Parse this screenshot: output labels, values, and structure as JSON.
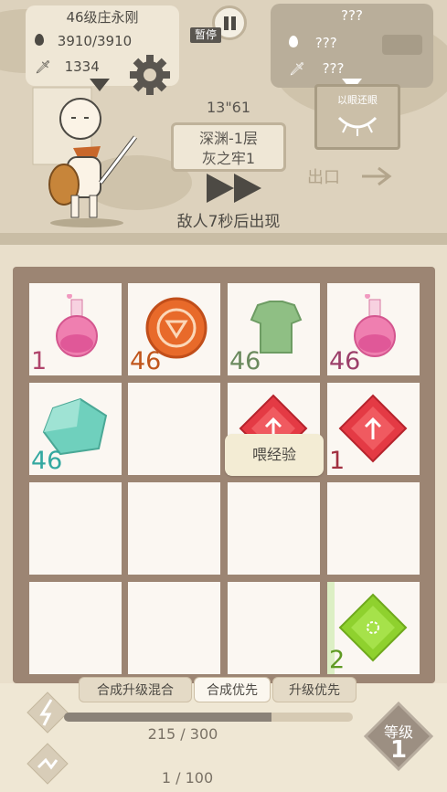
{
  "player": {
    "name": "46级庄永刚",
    "hp": "3910/3910",
    "attack": "1334"
  },
  "enemy": {
    "name": "???",
    "hp": "???",
    "attack": "???"
  },
  "pause_label": "暂停",
  "timer": "13\"61",
  "floor": {
    "line1": "深渊-1层",
    "line2": "灰之牢1"
  },
  "enemy_message": "敌人7秒后出现",
  "sign_label": "以眼还眼",
  "exit_label": "出口",
  "board": [
    [
      {
        "item": "potion",
        "num": "1",
        "color": "#b0456c"
      },
      {
        "item": "coin",
        "num": "46",
        "color": "#c0561c"
      },
      {
        "item": "armor",
        "num": "46",
        "color": "#6b8a5e"
      },
      {
        "item": "potion",
        "num": "46",
        "color": "#9c3f6a"
      }
    ],
    [
      {
        "item": "gem",
        "num": "46",
        "color": "#33a8a0"
      },
      {
        "item": "empty",
        "num": "",
        "color": ""
      },
      {
        "item": "redgem",
        "num": "",
        "color": ""
      },
      {
        "item": "redgem",
        "num": "1",
        "color": "#a23041"
      }
    ],
    [
      {
        "item": "empty",
        "num": "",
        "color": ""
      },
      {
        "item": "empty",
        "num": "",
        "color": ""
      },
      {
        "item": "empty",
        "num": "",
        "color": ""
      },
      {
        "item": "empty",
        "num": "",
        "color": ""
      }
    ],
    [
      {
        "item": "empty",
        "num": "",
        "color": ""
      },
      {
        "item": "empty",
        "num": "",
        "color": ""
      },
      {
        "item": "empty",
        "num": "",
        "color": ""
      },
      {
        "item": "greengem",
        "num": "2",
        "color": "#5f9a23"
      }
    ]
  ],
  "tooltip": "喂经验",
  "tabs": [
    "合成升级混合",
    "合成优先",
    "升级优先"
  ],
  "active_tab": 1,
  "exp": {
    "text": "215 / 300",
    "progress": 0.717
  },
  "counter": "1 / 100",
  "level": {
    "label": "等级",
    "value": "1"
  }
}
